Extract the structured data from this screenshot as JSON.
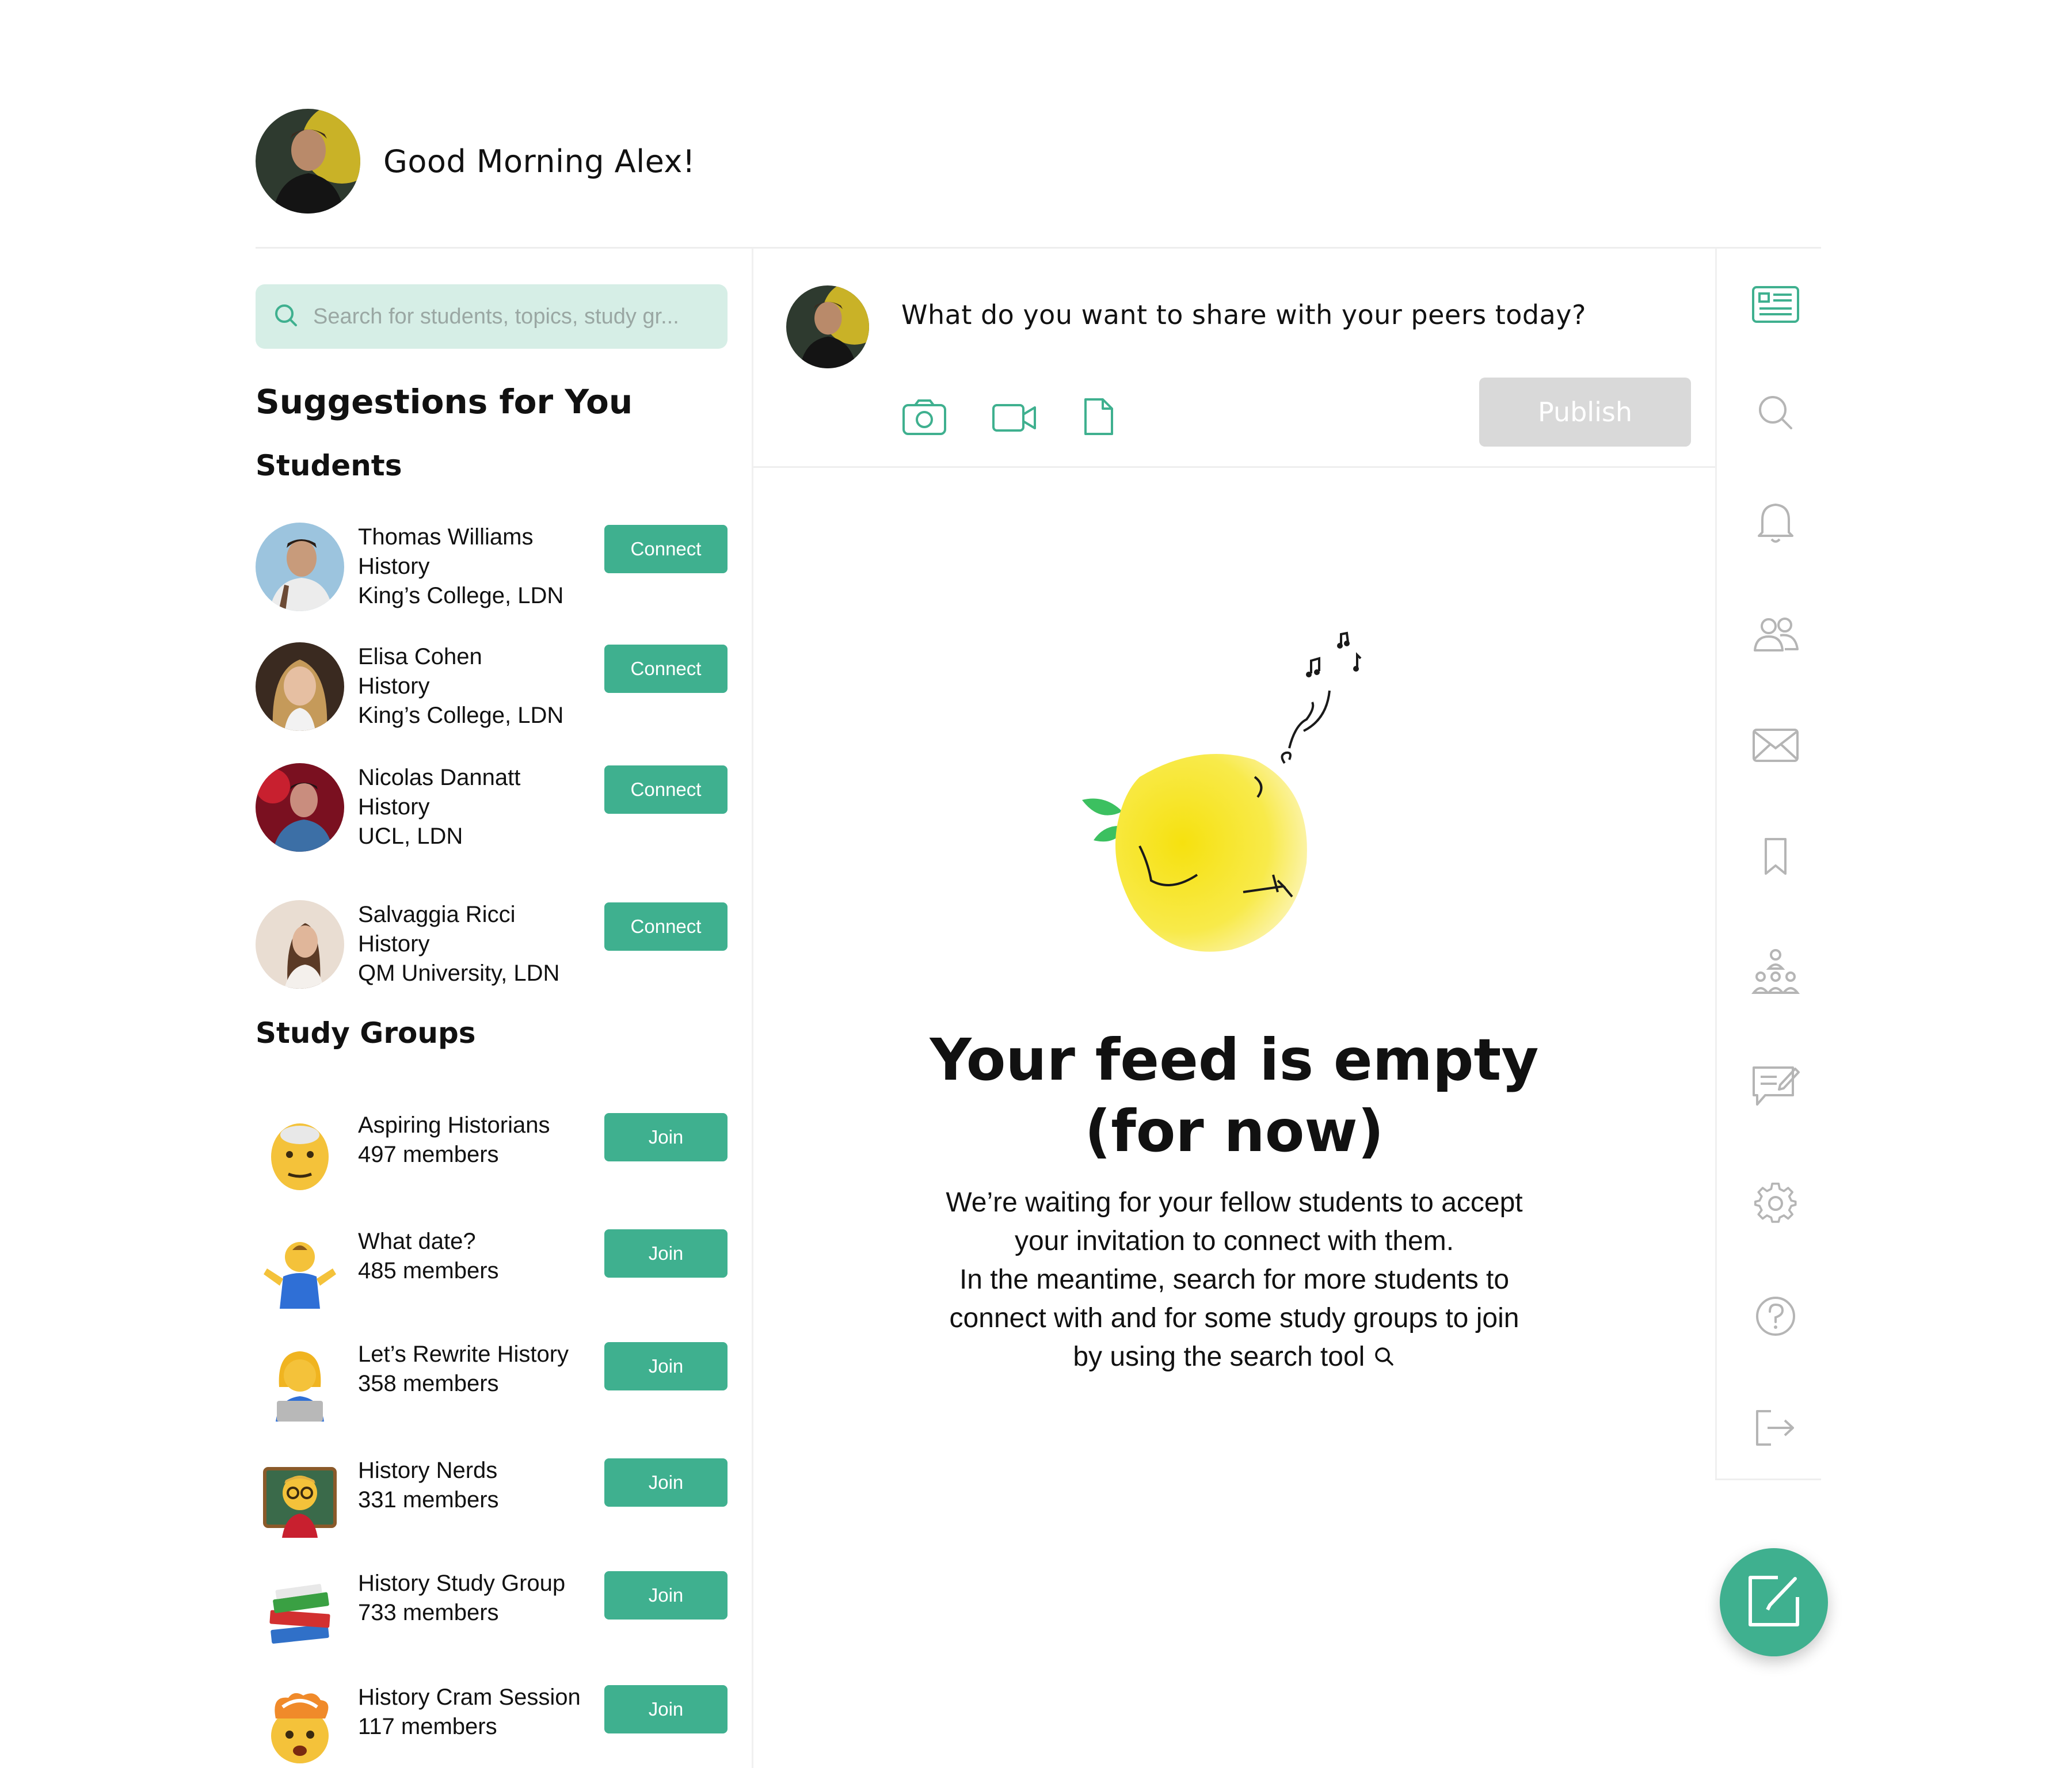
{
  "header": {
    "greeting": "Good Morning Alex!"
  },
  "search": {
    "placeholder": "Search for students, topics, study gr..."
  },
  "suggestions": {
    "title": "Suggestions for You",
    "students_title": "Students",
    "students": [
      {
        "name": "Thomas Williams",
        "subject": "History",
        "school": "King’s College, LDN",
        "action": "Connect"
      },
      {
        "name": "Elisa Cohen",
        "subject": "History",
        "school": "King’s College, LDN",
        "action": "Connect"
      },
      {
        "name": "Nicolas Dannatt",
        "subject": "History",
        "school": "UCL, LDN",
        "action": "Connect"
      },
      {
        "name": "Salvaggia Ricci",
        "subject": "History",
        "school": "QM University, LDN",
        "action": "Connect"
      }
    ],
    "groups_title": "Study Groups",
    "groups": [
      {
        "name": "Aspiring Historians",
        "members": "497 members",
        "action": "Join",
        "emoji": "👴"
      },
      {
        "name": "What date?",
        "members": "485 members",
        "action": "Join",
        "emoji": "🤷‍♂️"
      },
      {
        "name": "Let’s Rewrite History",
        "members": "358 members",
        "action": "Join",
        "emoji": "👩‍💻"
      },
      {
        "name": "History Nerds",
        "members": "331 members",
        "action": "Join",
        "emoji": "👨‍🏫"
      },
      {
        "name": "History Study Group",
        "members": "733 members",
        "action": "Join",
        "emoji": "📚"
      },
      {
        "name": "History Cram Session",
        "members": "117 members",
        "action": "Join",
        "emoji": "🤯"
      }
    ]
  },
  "composer": {
    "prompt": "What do you want to share with your peers today?",
    "publish_label": "Publish"
  },
  "empty_state": {
    "title_line1": "Your feed is empty",
    "title_line2": "(for now)",
    "body_lines": [
      "We’re waiting for your fellow students to accept",
      "your invitation to connect with them.",
      "In the meantime, search for more students to",
      "connect with and for some study groups to join",
      "by using the search tool"
    ]
  },
  "nav": {
    "icons": [
      "feed-icon",
      "search-icon",
      "bell-icon",
      "people-icon",
      "mail-icon",
      "bookmark-icon",
      "groups-icon",
      "chat-edit-icon",
      "gear-icon",
      "help-icon",
      "logout-icon"
    ]
  },
  "colors": {
    "accent": "#3fb08f",
    "search_bg": "#d6eee6",
    "publish_disabled": "#d9d9d9"
  }
}
